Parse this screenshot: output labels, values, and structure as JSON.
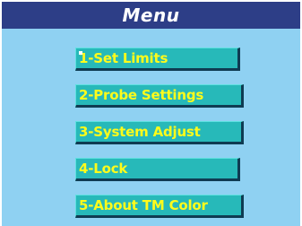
{
  "title": "Menu",
  "menu": {
    "items": [
      {
        "label": "1-Set Limits"
      },
      {
        "label": "2-Probe Settings"
      },
      {
        "label": "3-System Adjust"
      },
      {
        "label": "4-Lock"
      },
      {
        "label": "5-About TM Color"
      }
    ]
  },
  "colors": {
    "title_bar": "#2d3e87",
    "panel_background": "#8fd1f2",
    "item_background": "#27b9b9",
    "item_text": "#fffb1a"
  }
}
